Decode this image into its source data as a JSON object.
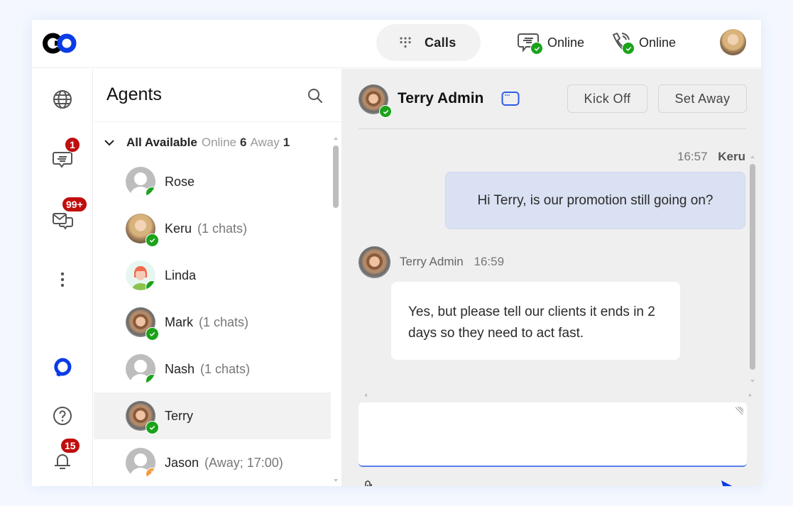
{
  "topbar": {
    "logo": "co-logo",
    "calls_label": "Calls",
    "chat_status_label": "Online",
    "phone_status_label": "Online",
    "user_avatar": "current-user-avatar"
  },
  "rail": {
    "items": [
      {
        "name": "globe",
        "icon": "globe-icon"
      },
      {
        "name": "chats",
        "icon": "chat-icon",
        "badge": "1"
      },
      {
        "name": "messages",
        "icon": "mail-chat-icon",
        "badge": "99+"
      },
      {
        "name": "more",
        "icon": "more-vertical-icon"
      },
      {
        "name": "brand",
        "icon": "brand-chat-icon"
      },
      {
        "name": "help",
        "icon": "help-icon"
      },
      {
        "name": "notifications",
        "icon": "bell-icon",
        "badge": "15"
      }
    ]
  },
  "agents": {
    "title": "Agents",
    "group": {
      "label": "All Available",
      "online_label": "Online",
      "online_count": "6",
      "away_label": "Away",
      "away_count": "1"
    },
    "list": [
      {
        "name": "Rose",
        "meta": "",
        "status": "online",
        "avatar": "generic"
      },
      {
        "name": "Keru",
        "meta": "(1 chats)",
        "status": "online",
        "avatar": "woman"
      },
      {
        "name": "Linda",
        "meta": "",
        "status": "online",
        "avatar": "linda"
      },
      {
        "name": "Mark",
        "meta": "(1 chats)",
        "status": "online",
        "avatar": "man"
      },
      {
        "name": "Nash",
        "meta": "(1 chats)",
        "status": "online",
        "avatar": "generic"
      },
      {
        "name": "Terry",
        "meta": "",
        "status": "online",
        "avatar": "man",
        "selected": true
      },
      {
        "name": "Jason",
        "meta": "(Away; 17:00)",
        "status": "away",
        "avatar": "generic"
      }
    ]
  },
  "chat": {
    "title": "Terry Admin",
    "kick_off_label": "Kick Off",
    "set_away_label": "Set Away",
    "messages": [
      {
        "direction": "out",
        "time": "16:57",
        "sender": "Keru",
        "text": "Hi Terry, is our promotion still going on?"
      },
      {
        "direction": "in",
        "time": "16:59",
        "sender": "Terry Admin",
        "text": "Yes, but please tell our clients it ends in 2 days so they need to act fast."
      }
    ],
    "composer_value": "",
    "composer_placeholder": ""
  },
  "colors": {
    "brand_blue": "#0a3be6",
    "online_green": "#1aa31a",
    "away_orange": "#f59a3a",
    "badge_red": "#c00d0d",
    "outgoing_bubble": "#dae1f2"
  }
}
